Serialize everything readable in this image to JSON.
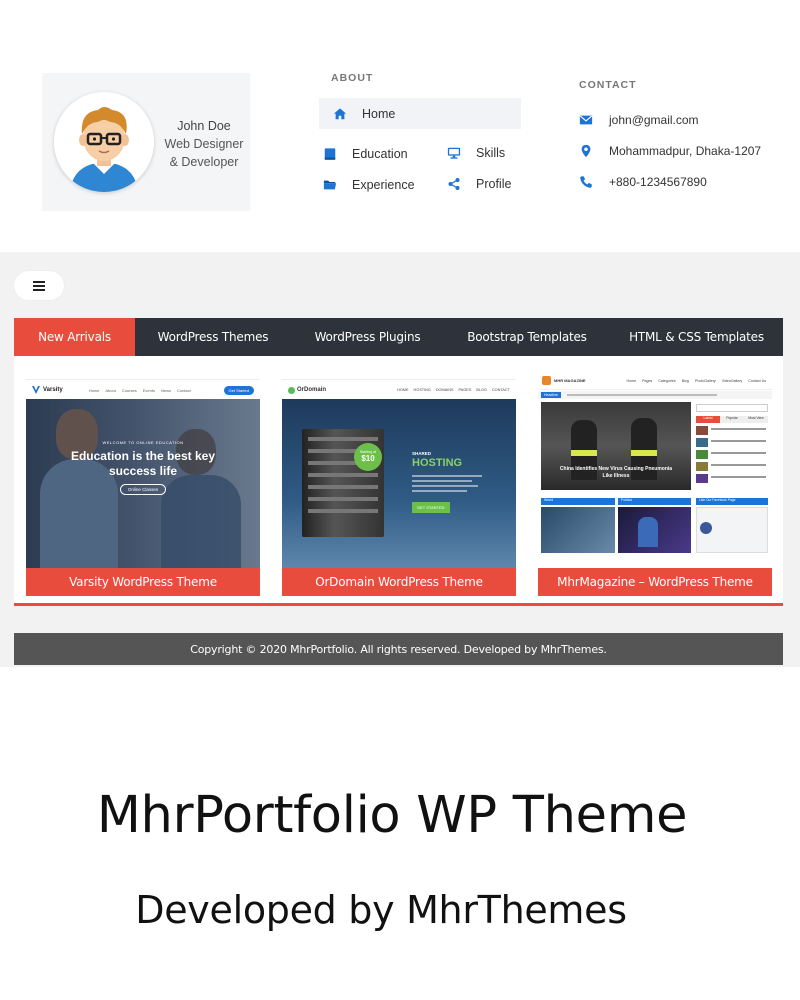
{
  "profile": {
    "name": "John Doe",
    "role_line1": "Web Designer",
    "role_line2": "& Developer"
  },
  "about": {
    "title": "ABOUT",
    "items": [
      {
        "label": "Home",
        "icon": "home-icon"
      },
      {
        "label": "Education",
        "icon": "book-icon"
      },
      {
        "label": "Skills",
        "icon": "monitor-icon"
      },
      {
        "label": "Experience",
        "icon": "folder-icon"
      },
      {
        "label": "Profile",
        "icon": "share-icon"
      }
    ]
  },
  "contact": {
    "title": "CONTACT",
    "email": "john@gmail.com",
    "address": "Mohammadpur, Dhaka-1207",
    "phone": "+880-1234567890"
  },
  "tabs": [
    {
      "label": "New Arrivals",
      "active": true
    },
    {
      "label": "WordPress Themes",
      "active": false
    },
    {
      "label": "WordPress Plugins",
      "active": false
    },
    {
      "label": "Bootstrap Templates",
      "active": false
    },
    {
      "label": "HTML & CSS Templates",
      "active": false
    }
  ],
  "products": [
    {
      "caption": "Varsity WordPress Theme",
      "preview": {
        "brand": "Varsity",
        "nav": [
          "Home",
          "About",
          "Courses",
          "Events",
          "News",
          "Contact"
        ],
        "cta": "Get Started",
        "eyebrow": "WELCOME TO ONLINE EDUCATION",
        "headline_line1": "Education is the best key",
        "headline_line2": "success life",
        "button": "Online Classes"
      }
    },
    {
      "caption": "OrDomain WordPress Theme",
      "preview": {
        "brand": "OrDomain",
        "nav": [
          "HOME",
          "HOSTING",
          "DOMAINS",
          "PAGES",
          "BLOG",
          "CONTACT"
        ],
        "badge_line1": "Starting at",
        "badge_price": "$10",
        "label_small": "SHARED",
        "label_big": "HOSTING",
        "button": "GET STARTED"
      }
    },
    {
      "caption": "MhrMagazine – WordPress Theme",
      "preview": {
        "brand": "MHR MAGAZINE",
        "nav": [
          "Home",
          "Pages",
          "Categories",
          "Blog",
          "PhotoGallery",
          "VideoGallery",
          "Contact Us"
        ],
        "ticker_label": "Headline",
        "headline_line1": "China Identifies New Virus Causing Pneumonia",
        "headline_line2": "Like Illness",
        "section1": "World",
        "section2": "Politics",
        "section3": "Like Our Facebook Page",
        "tab_labels": [
          "Latest",
          "Popular",
          "Most View"
        ]
      }
    }
  ],
  "footer": {
    "copyright": "Copyright © 2020 MhrPortfolio. All rights reserved. Developed by MhrThemes."
  },
  "promo": {
    "title": "MhrPortfolio WP Theme",
    "subtitle": "Developed by MhrThemes"
  },
  "colors": {
    "accent": "#e84c3d",
    "dark_tab_bar": "#2d323b",
    "icon_blue": "#1e74d6",
    "footer_bar": "#555555",
    "panel_bg": "#f2f2f2"
  }
}
